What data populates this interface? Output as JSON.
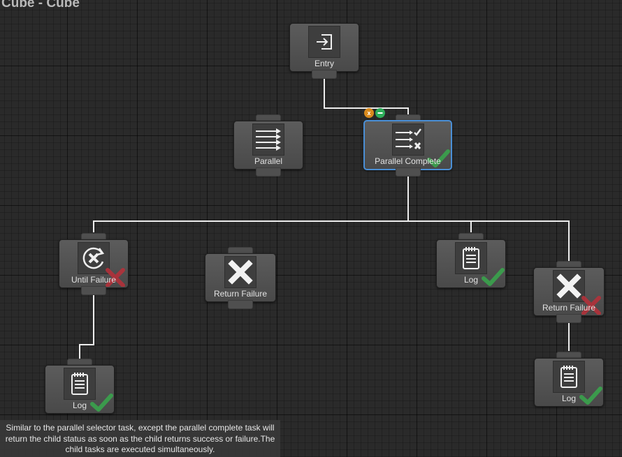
{
  "graph": {
    "title": "Cube - Cube"
  },
  "nodes": {
    "entry": {
      "label": "Entry",
      "icon": "entry-icon"
    },
    "parallel": {
      "label": "Parallel",
      "icon": "parallel-arrows-icon"
    },
    "parallel_complete": {
      "label": "Parallel Complete",
      "icon": "parallel-complete-icon",
      "status": "success",
      "selected": true
    },
    "until_failure": {
      "label": "Until Failure",
      "icon": "until-failure-icon",
      "status": "failure"
    },
    "return_failure_mid": {
      "label": "Return Failure",
      "icon": "return-failure-icon"
    },
    "log_mid": {
      "label": "Log",
      "icon": "log-icon",
      "status": "success"
    },
    "return_failure_right": {
      "label": "Return Failure",
      "icon": "return-failure-icon",
      "status": "failure"
    },
    "log_left": {
      "label": "Log",
      "icon": "log-icon",
      "status": "success"
    },
    "log_right": {
      "label": "Log",
      "icon": "log-icon",
      "status": "success"
    }
  },
  "badges": {
    "abort": "x"
  },
  "description": "Similar to the parallel selector task, except the parallel complete task will return the child status as soon as the child returns success or failure.The child tasks are executed simultaneously.",
  "colors": {
    "selection": "#4a8fd6",
    "success": "#3aa34c",
    "failure": "#b3313a",
    "abort_badge": "#d98a1d",
    "add_badge": "#2fae5a"
  }
}
